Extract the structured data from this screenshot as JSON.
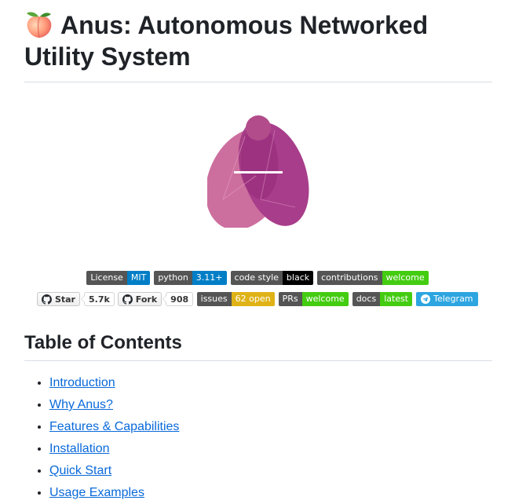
{
  "header": {
    "emoji": "🍑",
    "title": "Anus: Autonomous Networked Utility System"
  },
  "badges_row1": [
    {
      "left": "License",
      "right": "MIT",
      "color": "#007ec6"
    },
    {
      "left": "python",
      "right": "3.11+",
      "color": "#007ec6"
    },
    {
      "left": "code style",
      "right": "black",
      "color": "#000000"
    },
    {
      "left": "contributions",
      "right": "welcome",
      "color": "#44cc11"
    }
  ],
  "github_buttons": [
    {
      "label": "Star",
      "count": "5.7k",
      "icon": "github-icon"
    },
    {
      "label": "Fork",
      "count": "908",
      "icon": "github-icon"
    }
  ],
  "badges_row2": [
    {
      "left": "issues",
      "right": "62 open",
      "color": "#dfb317"
    },
    {
      "left": "PRs",
      "right": "welcome",
      "color": "#4c1"
    },
    {
      "left": "docs",
      "right": "latest",
      "color": "#4c1"
    }
  ],
  "telegram_badge": {
    "label": "Telegram",
    "color": "#2ca5e0",
    "icon": "telegram-icon"
  },
  "toc": {
    "heading": "Table of Contents",
    "items": [
      "Introduction",
      "Why Anus?",
      "Features & Capabilities",
      "Installation",
      "Quick Start",
      "Usage Examples"
    ]
  }
}
